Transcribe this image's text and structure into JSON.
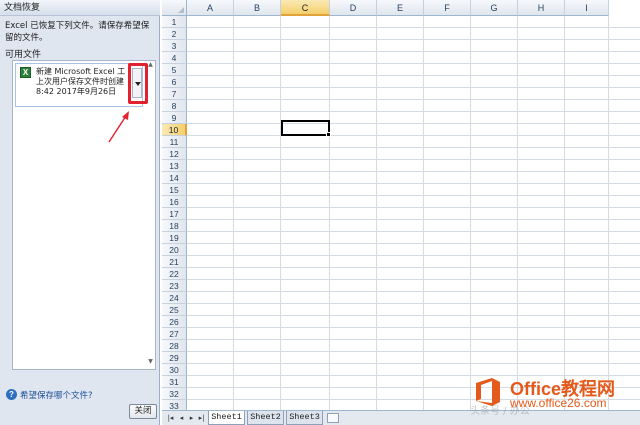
{
  "pane": {
    "title": "文档恢复",
    "description": "Excel 已恢复下列文件。请保存希望保留的文件。",
    "files_label": "可用文件",
    "file": {
      "icon": "excel-file-icon",
      "icon_glyph": "X",
      "name": "新建 Microsoft Excel 工",
      "desc": "上次用户保存文件时创建",
      "time": "8:42 2017年9月26日"
    },
    "help_link": "希望保存哪个文件?",
    "close_label": "关闭"
  },
  "grid": {
    "columns": [
      "A",
      "B",
      "C",
      "D",
      "E",
      "F",
      "G",
      "H",
      "I"
    ],
    "rows": [
      "1",
      "2",
      "3",
      "4",
      "5",
      "6",
      "7",
      "8",
      "9",
      "10",
      "11",
      "12",
      "13",
      "14",
      "15",
      "16",
      "17",
      "18",
      "19",
      "20",
      "21",
      "22",
      "23",
      "24",
      "25",
      "26",
      "27",
      "28",
      "29",
      "30",
      "31",
      "32",
      "33"
    ],
    "selected_column": "C",
    "selected_row": "10"
  },
  "sheets": {
    "tabs": [
      "Sheet1",
      "Sheet2",
      "Sheet3"
    ],
    "active": "Sheet1"
  },
  "watermark": {
    "name": "Office教程网",
    "url": "www.office26.com",
    "faint_text": "头条号 / 办公"
  },
  "colors": {
    "accent_highlight": "#e3202d",
    "selection_header": "#f4cf6d",
    "watermark_orange": "#e35a1c"
  }
}
